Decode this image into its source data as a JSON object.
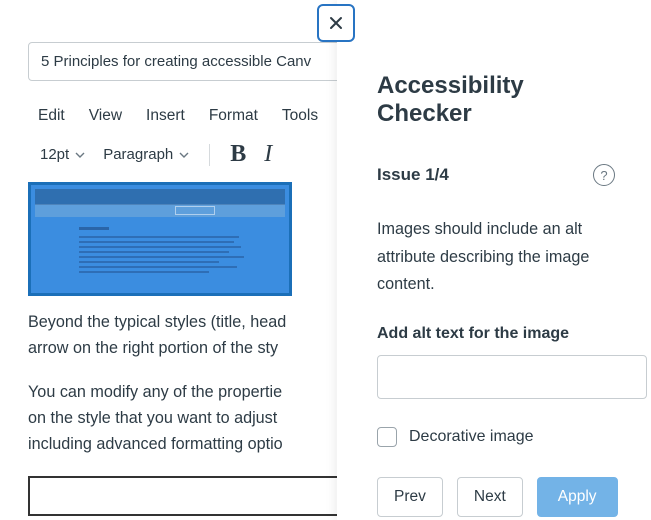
{
  "doc": {
    "title_value": "5 Principles for creating accessible Canv"
  },
  "menubar": {
    "items": [
      "Edit",
      "View",
      "Insert",
      "Format",
      "Tools"
    ]
  },
  "toolbar": {
    "font_size": "12pt",
    "block_style": "Paragraph"
  },
  "content": {
    "p1_line1": "Beyond the typical styles (title, head",
    "p1_line2": "arrow on the right portion of the sty",
    "p2_line1": "You can modify any of the propertie",
    "p2_line2": "on the style that you want to adjust",
    "p2_line3": "including advanced formatting optio"
  },
  "panel": {
    "title": "Accessibility Checker",
    "issue_label": "Issue 1/4",
    "help_glyph": "?",
    "description": "Images should include an alt attribute describing the image content.",
    "field_label": "Add alt text for the image",
    "alt_value": "",
    "decorative_label": "Decorative image",
    "prev": "Prev",
    "next": "Next",
    "apply": "Apply"
  }
}
